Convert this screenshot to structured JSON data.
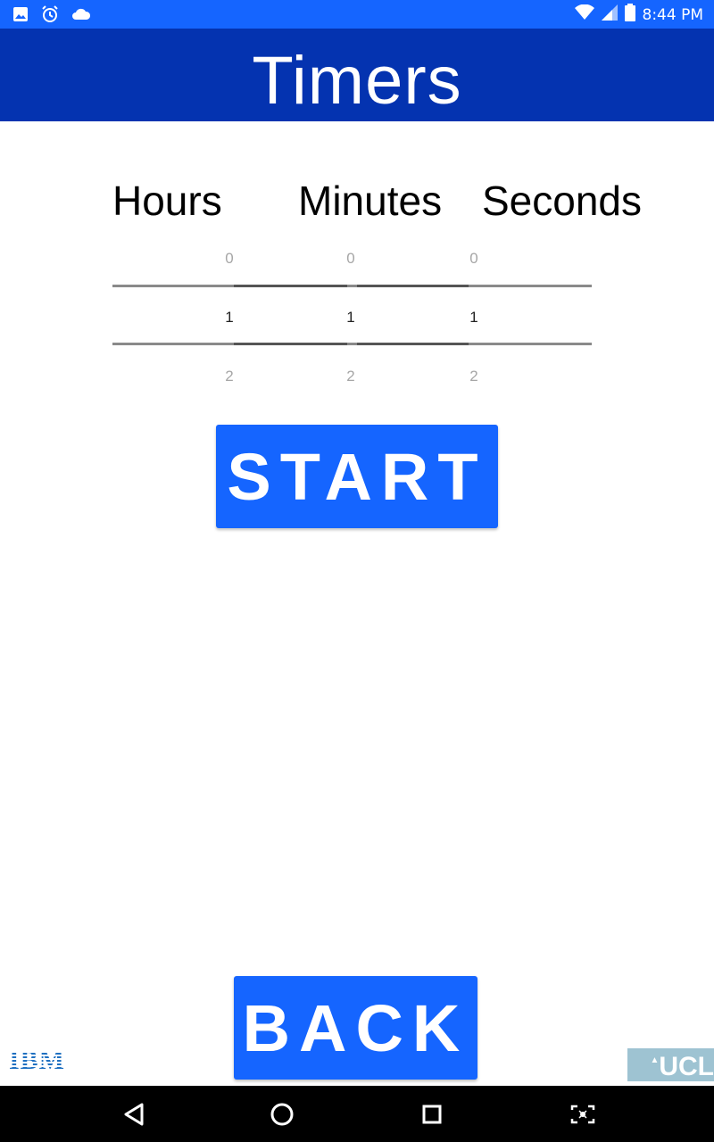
{
  "status_bar": {
    "time": "8:44 PM",
    "left_icons": [
      "image-icon",
      "alarm-icon",
      "cloud-icon"
    ],
    "right_icons": [
      "wifi-icon",
      "signal-icon",
      "battery-icon"
    ]
  },
  "header": {
    "title": "Timers"
  },
  "units": {
    "hours": "Hours",
    "minutes": "Minutes",
    "seconds": "Seconds"
  },
  "pickers": {
    "hours": {
      "prev": "0",
      "selected": "1",
      "next": "2"
    },
    "minutes": {
      "prev": "0",
      "selected": "1",
      "next": "2"
    },
    "seconds": {
      "prev": "0",
      "selected": "1",
      "next": "2"
    }
  },
  "buttons": {
    "start": "START",
    "back": "BACK"
  },
  "logos": {
    "ibm": "IBM",
    "ucl": "UCL"
  },
  "nav_bar": {
    "icons": [
      "back-triangle-icon",
      "home-circle-icon",
      "recents-square-icon",
      "screenshot-icon"
    ]
  },
  "colors": {
    "status_bar": "#1565ff",
    "title_bar": "#0433b0",
    "button": "#1565ff"
  }
}
